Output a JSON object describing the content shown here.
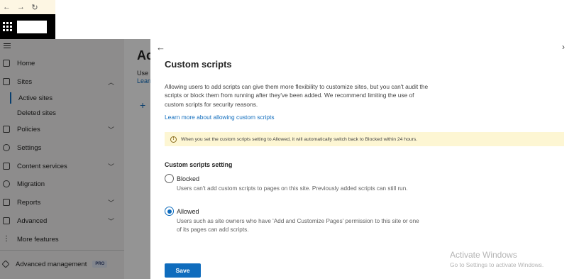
{
  "browser": {
    "back_glyph": "←",
    "forward_glyph": "→",
    "refresh_glyph": "↻"
  },
  "suite": {
    "waffle_icon": "waffle-icon"
  },
  "nav": {
    "items": [
      {
        "label": "Home",
        "icon": "home-icon"
      },
      {
        "label": "Sites",
        "icon": "sites-icon",
        "chevron": "^"
      },
      {
        "label": "Policies",
        "icon": "policies-icon",
        "chevron": "v"
      },
      {
        "label": "Settings",
        "icon": "gear-icon"
      },
      {
        "label": "Content services",
        "icon": "content-services-icon",
        "chevron": "v"
      },
      {
        "label": "Migration",
        "icon": "migration-icon"
      },
      {
        "label": "Reports",
        "icon": "reports-icon",
        "chevron": "v"
      },
      {
        "label": "Advanced",
        "icon": "advanced-icon",
        "chevron": "v"
      },
      {
        "label": "More features",
        "icon": "more-icon"
      },
      {
        "label": "Advanced management",
        "icon": "diamond-icon",
        "badge": "PRO"
      }
    ],
    "sub_items": [
      "Active sites",
      "Deleted sites"
    ]
  },
  "main": {
    "title": "Ac",
    "text1": "Use",
    "text2": "Learn",
    "add_glyph": "+"
  },
  "panel": {
    "back_glyph": "←",
    "forward_glyph": "›",
    "title": "Custom scripts",
    "description": "Allowing users to add scripts can give them more flexibility to customize sites, but you can't audit the scripts or block them from running after they've been added. We recommend limiting the use of custom scripts for security reasons.",
    "learn_more": "Learn more about allowing custom scripts",
    "warning_icon_glyph": "!",
    "warning": "When you set the custom scripts setting to Allowed, it will automatically switch back to Blocked within 24 hours.",
    "section_label": "Custom scripts setting",
    "options": [
      {
        "label": "Blocked",
        "description": "Users can't add custom scripts to pages on this site. Previously added scripts can still run.",
        "selected": false
      },
      {
        "label": "Allowed",
        "description": "Users such as site owners who have 'Add and Customize Pages' permission to this site or one of its pages can add scripts.",
        "selected": true
      }
    ],
    "save_label": "Save"
  },
  "watermark": {
    "line1": "Activate Windows",
    "line2": "Go to Settings to activate Windows."
  },
  "colors": {
    "accent": "#0f6cbd",
    "warning_bg": "#fdf6d3"
  }
}
